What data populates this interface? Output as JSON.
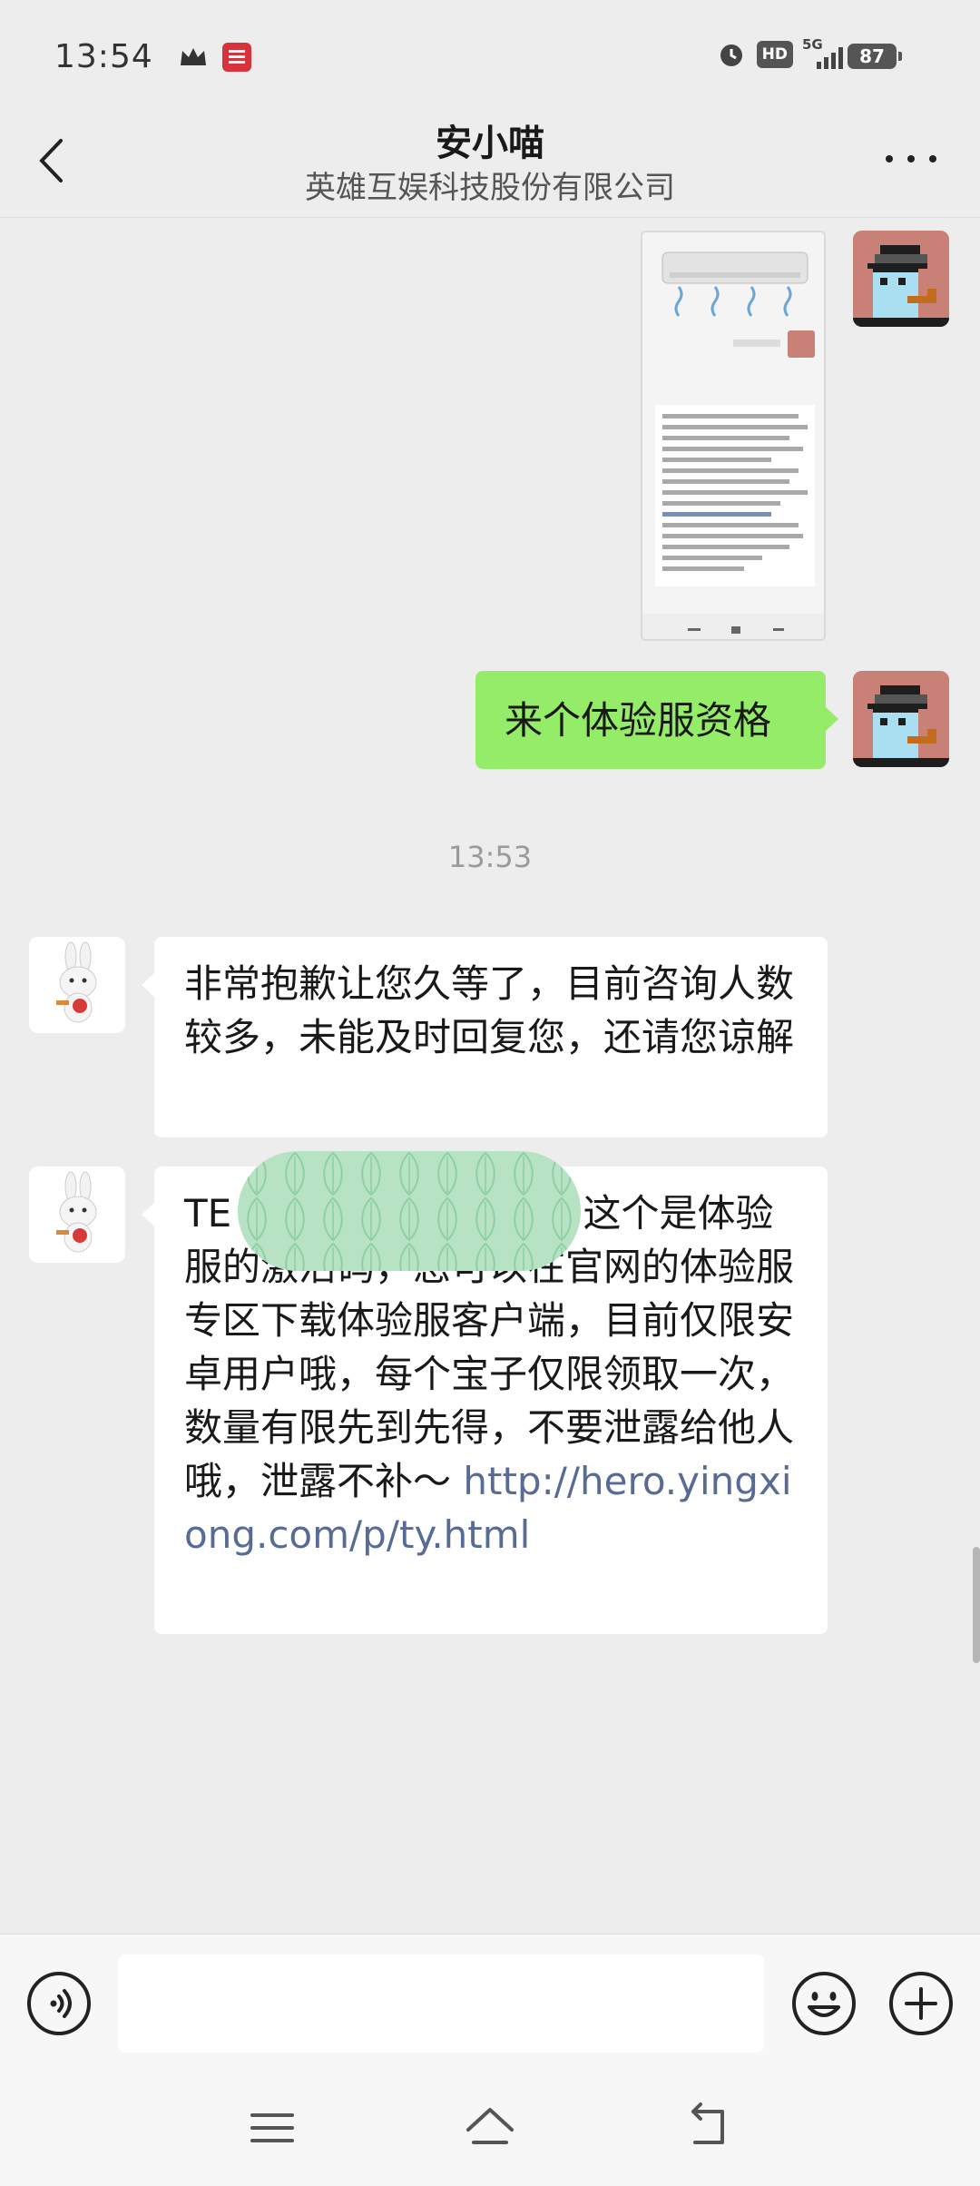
{
  "status_bar": {
    "time": "13:54",
    "hd_label": "HD",
    "network_label": "5G",
    "battery_level": "87"
  },
  "header": {
    "title": "安小喵",
    "subtitle": "英雄互娱科技股份有限公司"
  },
  "messages": [
    {
      "type": "image",
      "sender": "self"
    },
    {
      "type": "text",
      "sender": "self",
      "text": "来个体验服资格"
    },
    {
      "type": "time",
      "text": "13:53"
    },
    {
      "type": "text",
      "sender": "bot",
      "text": "非常抱歉让您久等了，目前咨询人数较多，未能及时回复您，还请您谅解"
    },
    {
      "type": "text",
      "sender": "bot",
      "text": "TE",
      "text_after": " 这个是体验服的激活码，您可以在官网的体验服专区下载体验服客户端，目前仅限安卓用户哦，每个宝子仅限领取一次，数量有限先到先得，不要泄露给他人哦，泄露不补～",
      "link": "http://hero.yingxiong.com/p/ty.html"
    }
  ],
  "input": {
    "value": ""
  },
  "colors": {
    "background": "#ededed",
    "self_bubble": "#95ec69",
    "bot_bubble": "#ffffff",
    "link": "#576b95"
  },
  "icons": {
    "back": "chevron-left-icon",
    "more": "more-dots-icon",
    "voice": "voice-icon",
    "emoji": "emoji-icon",
    "plus": "plus-icon",
    "nav_menu": "menu-icon",
    "nav_home": "home-icon",
    "nav_back": "back-arrow-icon"
  }
}
